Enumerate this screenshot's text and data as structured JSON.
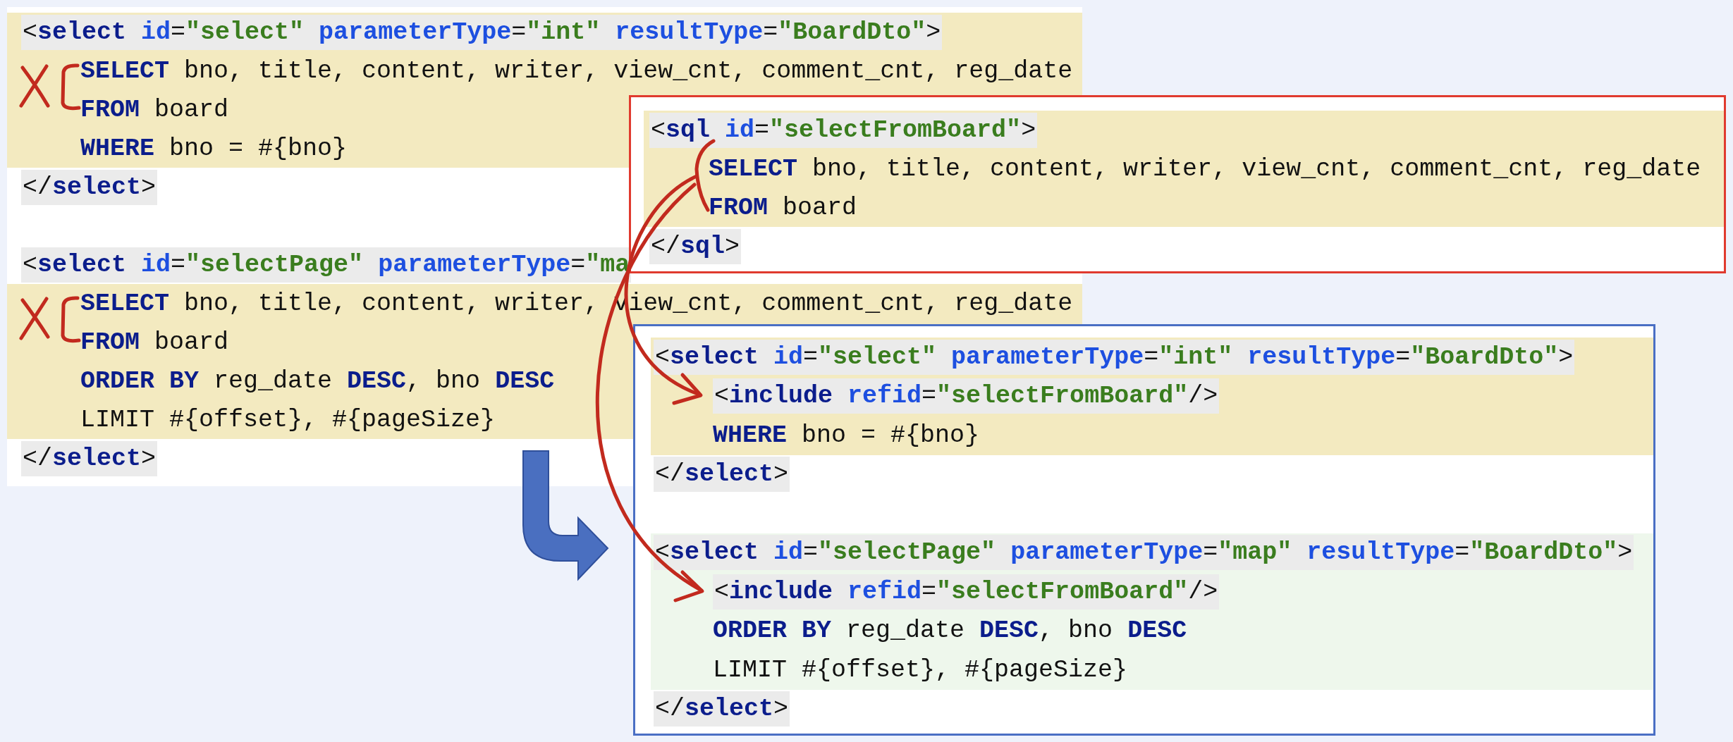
{
  "original": {
    "lines": [
      {
        "kind": "tag",
        "color": "#f3eac0",
        "tokens": [
          {
            "kind": "plain",
            "text": "<"
          },
          {
            "kind": "keyword",
            "text": "select"
          },
          {
            "kind": "attr",
            "text": " id"
          },
          {
            "kind": "plain",
            "text": "="
          },
          {
            "kind": "value",
            "text": "\"select\""
          },
          {
            "kind": "attr",
            "text": " parameterType"
          },
          {
            "kind": "plain",
            "text": "="
          },
          {
            "kind": "value",
            "text": "\"int\""
          },
          {
            "kind": "attr",
            "text": " resultType"
          },
          {
            "kind": "plain",
            "text": "="
          },
          {
            "kind": "value",
            "text": "\"BoardDto\""
          },
          {
            "kind": "plain",
            "text": ">"
          }
        ]
      },
      {
        "kind": "body",
        "color": "#f3eac0",
        "tokens": [
          {
            "kind": "keyword",
            "text": "SELECT"
          },
          {
            "kind": "plain",
            "text": " bno, title, content, writer, view_cnt, comment_cnt, reg_date"
          }
        ]
      },
      {
        "kind": "body",
        "color": "#f3eac0",
        "tokens": [
          {
            "kind": "keyword",
            "text": "FROM"
          },
          {
            "kind": "plain",
            "text": " board"
          }
        ]
      },
      {
        "kind": "body",
        "color": "#f3eac0",
        "tokens": [
          {
            "kind": "keyword",
            "text": "WHERE"
          },
          {
            "kind": "plain",
            "text": " bno = #{bno}"
          }
        ]
      },
      {
        "kind": "tag",
        "tokens": [
          {
            "kind": "plain",
            "text": "</"
          },
          {
            "kind": "keyword",
            "text": "select"
          },
          {
            "kind": "plain",
            "text": ">"
          }
        ]
      },
      {
        "kind": "blank"
      },
      {
        "kind": "tag",
        "tokens": [
          {
            "kind": "plain",
            "text": "<"
          },
          {
            "kind": "keyword",
            "text": "select"
          },
          {
            "kind": "attr",
            "text": " id"
          },
          {
            "kind": "plain",
            "text": "="
          },
          {
            "kind": "value",
            "text": "\"selectPage\""
          },
          {
            "kind": "attr",
            "text": " parameterType"
          },
          {
            "kind": "plain",
            "text": "="
          },
          {
            "kind": "value",
            "text": "\"ma"
          }
        ]
      },
      {
        "kind": "body",
        "color": "#f3eac0",
        "tokens": [
          {
            "kind": "keyword",
            "text": "SELECT"
          },
          {
            "kind": "plain",
            "text": " bno, title, content, writer, view_cnt, comment_cnt, reg_date"
          }
        ]
      },
      {
        "kind": "body",
        "color": "#f3eac0",
        "tokens": [
          {
            "kind": "keyword",
            "text": "FROM"
          },
          {
            "kind": "plain",
            "text": " board"
          }
        ]
      },
      {
        "kind": "body",
        "color": "#f3eac0",
        "tokens": [
          {
            "kind": "keyword",
            "text": "ORDER BY"
          },
          {
            "kind": "plain",
            "text": " reg_date "
          },
          {
            "kind": "keyword",
            "text": "DESC"
          },
          {
            "kind": "plain",
            "text": ", bno "
          },
          {
            "kind": "keyword",
            "text": "DESC"
          }
        ]
      },
      {
        "kind": "body",
        "color": "#f3eac0",
        "tokens": [
          {
            "kind": "plain",
            "text": "LIMIT #{offset}, #{pageSize}"
          }
        ]
      },
      {
        "kind": "tag",
        "tokens": [
          {
            "kind": "plain",
            "text": "</"
          },
          {
            "kind": "keyword",
            "text": "select"
          },
          {
            "kind": "plain",
            "text": ">"
          }
        ]
      }
    ]
  },
  "sql_fragment": {
    "lines": [
      {
        "kind": "tag",
        "color": "#f3eac0",
        "tokens": [
          {
            "kind": "plain",
            "text": "<"
          },
          {
            "kind": "keyword",
            "text": "sql"
          },
          {
            "kind": "attr",
            "text": " id"
          },
          {
            "kind": "plain",
            "text": "="
          },
          {
            "kind": "value",
            "text": "\"selectFromBoard\""
          },
          {
            "kind": "plain",
            "text": ">"
          }
        ]
      },
      {
        "kind": "body",
        "color": "#f3eac0",
        "tokens": [
          {
            "kind": "keyword",
            "text": "SELECT"
          },
          {
            "kind": "plain",
            "text": " bno, title, content, writer, view_cnt, comment_cnt, reg_date"
          }
        ]
      },
      {
        "kind": "body",
        "color": "#f3eac0",
        "tokens": [
          {
            "kind": "keyword",
            "text": "FROM"
          },
          {
            "kind": "plain",
            "text": " board"
          }
        ]
      },
      {
        "kind": "tag",
        "tokens": [
          {
            "kind": "plain",
            "text": "</"
          },
          {
            "kind": "keyword",
            "text": "sql"
          },
          {
            "kind": "plain",
            "text": ">"
          }
        ]
      }
    ]
  },
  "refactored": {
    "lines": [
      {
        "kind": "tag",
        "color": "#f3eac0",
        "tokens": [
          {
            "kind": "plain",
            "text": "<"
          },
          {
            "kind": "keyword",
            "text": "select"
          },
          {
            "kind": "attr",
            "text": " id"
          },
          {
            "kind": "plain",
            "text": "="
          },
          {
            "kind": "value",
            "text": "\"select\""
          },
          {
            "kind": "attr",
            "text": " parameterType"
          },
          {
            "kind": "plain",
            "text": "="
          },
          {
            "kind": "value",
            "text": "\"int\""
          },
          {
            "kind": "attr",
            "text": " resultType"
          },
          {
            "kind": "plain",
            "text": "="
          },
          {
            "kind": "value",
            "text": "\"BoardDto\""
          },
          {
            "kind": "plain",
            "text": ">"
          }
        ]
      },
      {
        "kind": "nested_tag",
        "color": "#f3eac0",
        "tokens": [
          {
            "kind": "plain",
            "text": "<"
          },
          {
            "kind": "keyword",
            "text": "include"
          },
          {
            "kind": "attr",
            "text": " refid"
          },
          {
            "kind": "plain",
            "text": "="
          },
          {
            "kind": "value",
            "text": "\"selectFromBoard\""
          },
          {
            "kind": "plain",
            "text": "/>"
          }
        ]
      },
      {
        "kind": "body",
        "color": "#f3eac0",
        "tokens": [
          {
            "kind": "keyword",
            "text": "WHERE"
          },
          {
            "kind": "plain",
            "text": " bno = #{bno}"
          }
        ]
      },
      {
        "kind": "tag",
        "tokens": [
          {
            "kind": "plain",
            "text": "</"
          },
          {
            "kind": "keyword",
            "text": "select"
          },
          {
            "kind": "plain",
            "text": ">"
          }
        ]
      },
      {
        "kind": "blank"
      },
      {
        "kind": "tag",
        "color": "#eef7ec",
        "tokens": [
          {
            "kind": "plain",
            "text": "<"
          },
          {
            "kind": "keyword",
            "text": "select"
          },
          {
            "kind": "attr",
            "text": " id"
          },
          {
            "kind": "plain",
            "text": "="
          },
          {
            "kind": "value",
            "text": "\"selectPage\""
          },
          {
            "kind": "attr",
            "text": " parameterType"
          },
          {
            "kind": "plain",
            "text": "="
          },
          {
            "kind": "value",
            "text": "\"map\""
          },
          {
            "kind": "attr",
            "text": " resultType"
          },
          {
            "kind": "plain",
            "text": "="
          },
          {
            "kind": "value",
            "text": "\"BoardDto\""
          },
          {
            "kind": "plain",
            "text": ">"
          }
        ]
      },
      {
        "kind": "nested_tag",
        "color": "#eef7ec",
        "tokens": [
          {
            "kind": "plain",
            "text": "<"
          },
          {
            "kind": "keyword",
            "text": "include"
          },
          {
            "kind": "attr",
            "text": " refid"
          },
          {
            "kind": "plain",
            "text": "="
          },
          {
            "kind": "value",
            "text": "\"selectFromBoard\""
          },
          {
            "kind": "plain",
            "text": "/>"
          }
        ]
      },
      {
        "kind": "body",
        "color": "#eef7ec",
        "tokens": [
          {
            "kind": "keyword",
            "text": "ORDER BY"
          },
          {
            "kind": "plain",
            "text": " reg_date "
          },
          {
            "kind": "keyword",
            "text": "DESC"
          },
          {
            "kind": "plain",
            "text": ", bno "
          },
          {
            "kind": "keyword",
            "text": "DESC"
          }
        ]
      },
      {
        "kind": "body",
        "color": "#eef7ec",
        "tokens": [
          {
            "kind": "plain",
            "text": "LIMIT #{offset}, #{pageSize}"
          }
        ]
      },
      {
        "kind": "tag",
        "tokens": [
          {
            "kind": "plain",
            "text": "</"
          },
          {
            "kind": "keyword",
            "text": "select"
          },
          {
            "kind": "plain",
            "text": ">"
          }
        ]
      }
    ]
  }
}
